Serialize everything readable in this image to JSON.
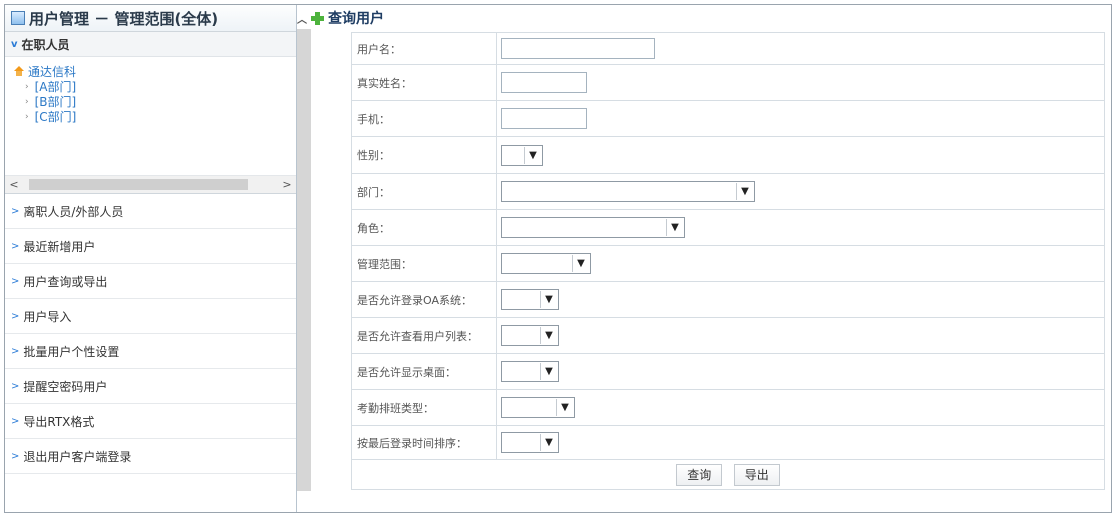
{
  "left": {
    "title": "用户管理 － 管理范围(全体)",
    "open_section": "在职人员",
    "tree": {
      "root": "通达信科",
      "children": [
        "[A部门]",
        "[B部门]",
        "[C部门]"
      ]
    },
    "scroll_left": "<",
    "scroll_right": ">",
    "sections": [
      "离职人员/外部人员",
      "最近新增用户",
      "用户查询或导出",
      "用户导入",
      "批量用户个性设置",
      "提醒空密码用户",
      "导出RTX格式",
      "退出用户客户端登录"
    ]
  },
  "right": {
    "title": "查询用户",
    "fields": {
      "username": "用户名：",
      "real_name": "真实姓名：",
      "mobile": "手机：",
      "gender": "性别：",
      "dept": "部门：",
      "role": "角色：",
      "manage_scope": "管理范围：",
      "allow_oa_login": "是否允许登录OA系统：",
      "allow_view_user_list": "是否允许查看用户列表：",
      "allow_show_desktop": "是否允许显示桌面：",
      "attendance_type": "考勤排班类型：",
      "sort_last_login": "按最后登录时间排序："
    },
    "buttons": {
      "query": "查询",
      "export": "导出"
    }
  },
  "icons": {
    "caret": "▼",
    "chevron_right": ">",
    "chevron_down": "v"
  }
}
